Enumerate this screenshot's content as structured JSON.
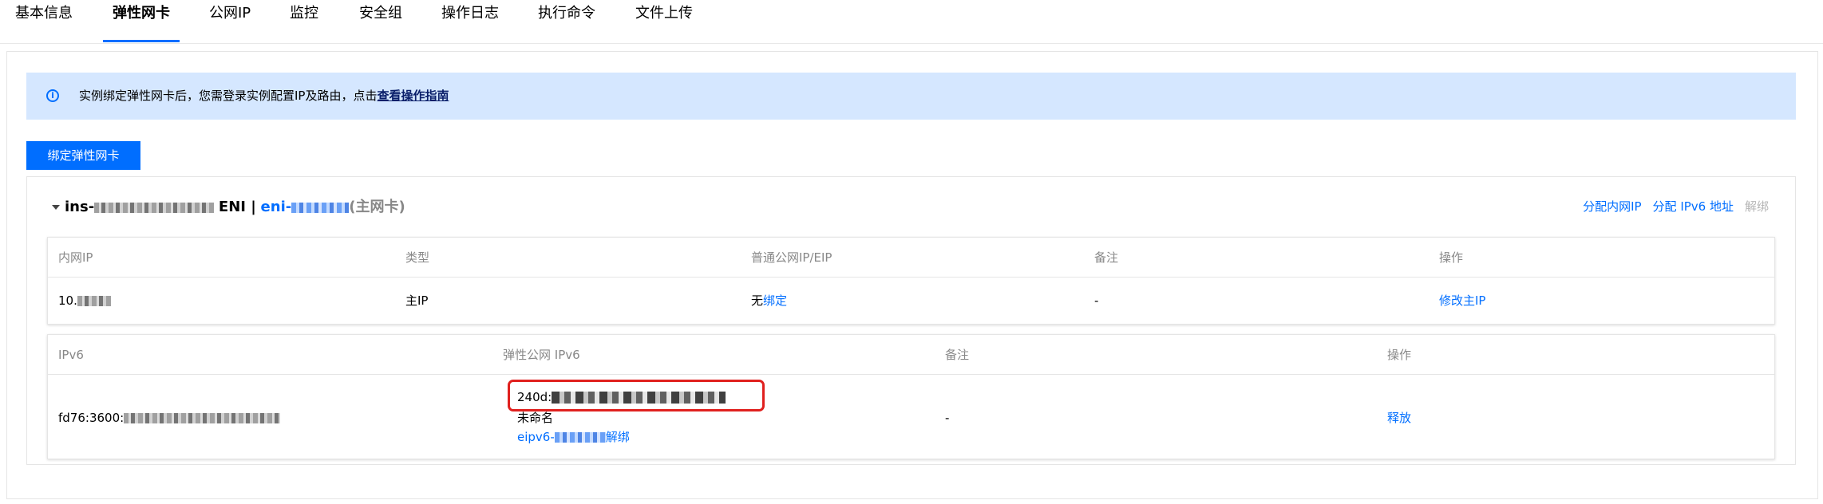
{
  "tabs": [
    "基本信息",
    "弹性网卡",
    "公网IP",
    "监控",
    "安全组",
    "操作日志",
    "执行命令",
    "文件上传"
  ],
  "active_tab": "弹性网卡",
  "alert": {
    "icon": "info-icon",
    "text": "实例绑定弹性网卡后，您需登录实例配置IP及路由，点击",
    "link": "查看操作指南"
  },
  "bind_button": "绑定弹性网卡",
  "eni_card": {
    "instance_prefix": "ins-",
    "eni_word": "ENI |",
    "eni_prefix": "eni-",
    "primary_tag": "(主网卡)",
    "actions": [
      "分配内网IP",
      "分配 IPv6 地址",
      "解绑"
    ]
  },
  "ipv4_table": {
    "headers": [
      "内网IP",
      "类型",
      "普通公网IP/EIP",
      "备注",
      "操作"
    ],
    "row": {
      "ip_prefix": "10.",
      "type": "主IP",
      "eip_none": "无",
      "eip_bind": "绑定",
      "remark": "-",
      "action": "修改主IP"
    }
  },
  "ipv6_table": {
    "headers": [
      "IPv6",
      "弹性公网 IPv6",
      "备注",
      "操作"
    ],
    "row": {
      "ipv6_prefix": "fd76:3600:",
      "eip6_prefix": "240d:",
      "eip6_name": "未命名",
      "eip6_id_prefix": "eipv6-",
      "eip6_unbind": "解绑",
      "remark": "-",
      "action": "释放"
    }
  },
  "colors": {
    "accent": "#006eff",
    "alert_bg": "#d5e7ff",
    "highlight": "#e0201e"
  }
}
